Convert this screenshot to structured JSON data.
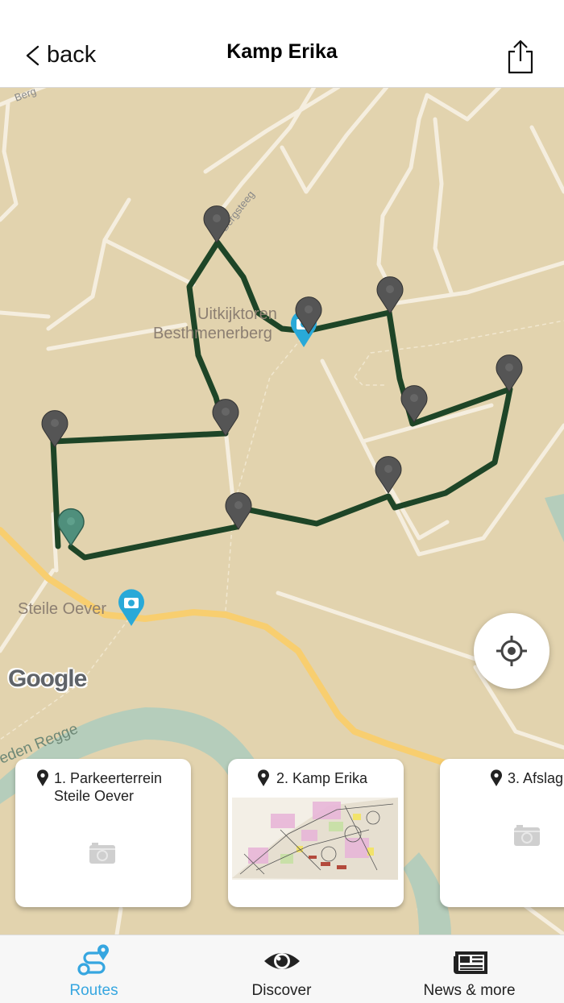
{
  "header": {
    "back_label": "back",
    "title": "Kamp Erika"
  },
  "map": {
    "road_labels": [
      "Berg",
      "Bergsteeg",
      "eden Regge"
    ],
    "poi_labels": {
      "tower": "Uitkijktoren\nBesthmenerberg",
      "steile": "Steile Oever"
    },
    "attribution": "Google",
    "route_color": "#1e4527",
    "marker_color": "#555555",
    "start_marker_color": "#4f8f7c",
    "poi_marker_color": "#29a9d8"
  },
  "cards": [
    {
      "title": "1. Parkeerterrein Steile Oever",
      "has_image": false
    },
    {
      "title": "2. Kamp Erika",
      "has_image": true
    },
    {
      "title": "3. Afslag",
      "has_image": false
    }
  ],
  "tabs": [
    {
      "label": "Routes",
      "icon": "route-icon",
      "active": true
    },
    {
      "label": "Discover",
      "icon": "eye-icon",
      "active": false
    },
    {
      "label": "News & more",
      "icon": "newspaper-icon",
      "active": false
    }
  ],
  "colors": {
    "accent": "#36a6e0",
    "map_background": "#e2d3ae",
    "tab_inactive": "#222222"
  }
}
